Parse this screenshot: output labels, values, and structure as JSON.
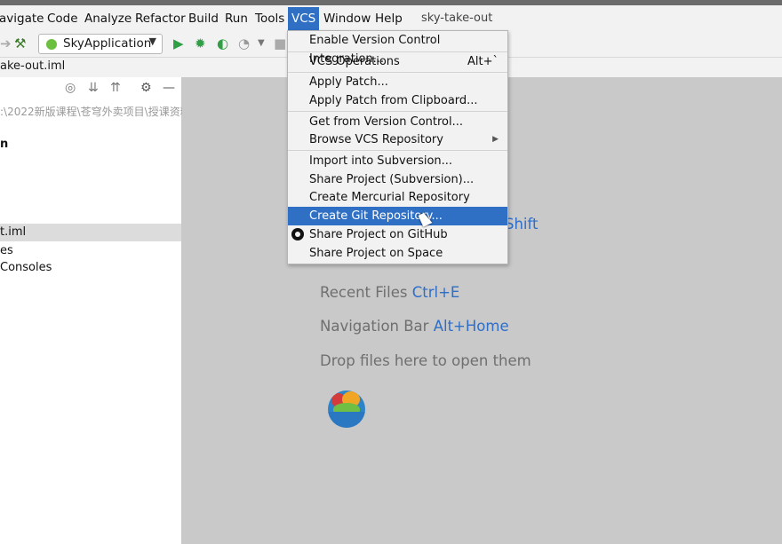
{
  "menubar": {
    "items": [
      "avigate",
      "Code",
      "Analyze",
      "Refactor",
      "Build",
      "Run",
      "Tools",
      "VCS",
      "Window",
      "Help"
    ],
    "app_title": "sky-take-out"
  },
  "toolbar": {
    "run_config": "SkyApplication"
  },
  "pathbar": {
    "file": "ake-out.iml"
  },
  "sidebar": {
    "path": ":\\2022新版课程\\苍穹外卖项目\\授课资料",
    "items": [
      "n",
      "t.iml",
      "es",
      "Consoles"
    ]
  },
  "vcs_menu": {
    "items": [
      {
        "label": "Enable Version Control Integration...",
        "shortcut": ""
      },
      {
        "label": "VCS Operations",
        "shortcut": "Alt+`"
      },
      {
        "label": "Apply Patch...",
        "shortcut": ""
      },
      {
        "label": "Apply Patch from Clipboard...",
        "shortcut": ""
      },
      {
        "label": "Get from Version Control...",
        "shortcut": ""
      },
      {
        "label": "Browse VCS Repository",
        "shortcut": "▶"
      },
      {
        "label": "Import into Subversion...",
        "shortcut": ""
      },
      {
        "label": "Share Project (Subversion)...",
        "shortcut": ""
      },
      {
        "label": "Create Mercurial Repository",
        "shortcut": ""
      },
      {
        "label": "Create Git Repository...",
        "shortcut": ""
      },
      {
        "label": "Share Project on GitHub",
        "shortcut": ""
      },
      {
        "label": "Share Project on Space",
        "shortcut": ""
      }
    ]
  },
  "editor": {
    "partial_shortcut": "Shift",
    "hints": [
      {
        "label": "Recent Files",
        "shortcut": "Ctrl+E"
      },
      {
        "label": "Navigation Bar",
        "shortcut": "Alt+Home"
      },
      {
        "label": "Drop files here to open them",
        "shortcut": ""
      }
    ]
  },
  "colors": {
    "accent": "#2f6fc4",
    "shortcut": "#2f6ec7",
    "editor_bg": "#c9c9c9"
  }
}
